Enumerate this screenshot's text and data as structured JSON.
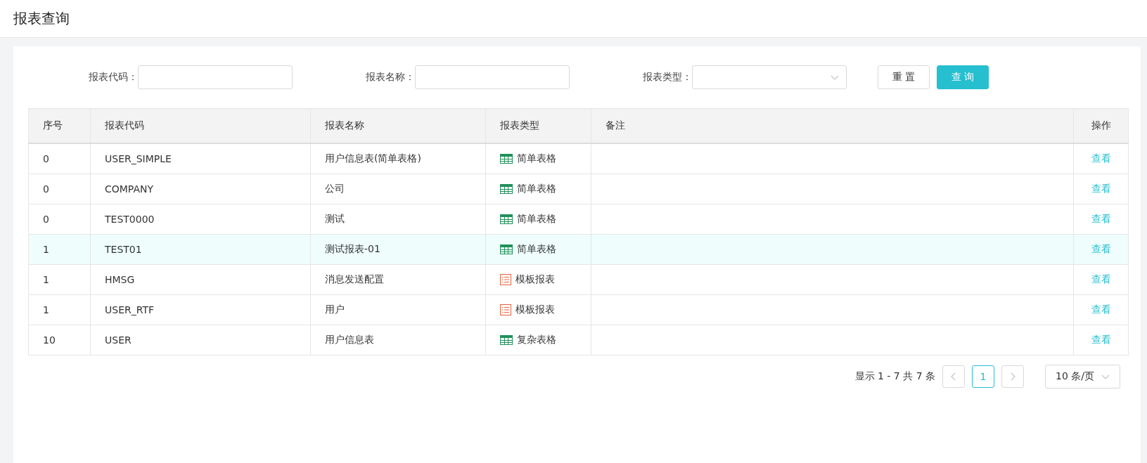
{
  "page_title": "报表查询",
  "filters": [
    {
      "label": "报表代码：",
      "kind": "text"
    },
    {
      "label": "报表名称：",
      "kind": "text"
    },
    {
      "label": "报表类型：",
      "kind": "select"
    }
  ],
  "buttons": [
    {
      "label": "重 置",
      "kind": "default"
    },
    {
      "label": "查 询",
      "kind": "primary"
    }
  ],
  "table": {
    "columns": [
      "序号",
      "报表代码",
      "报表名称",
      "报表类型",
      "备注",
      "操作"
    ],
    "rows": [
      {
        "index": "0",
        "code": "USER_SIMPLE",
        "name": "用户信息表(简单表格)",
        "type": "简单表格",
        "kind": "table",
        "action": "查看",
        "highlighted": false
      },
      {
        "index": "0",
        "code": "COMPANY",
        "name": "公司",
        "type": "简单表格",
        "kind": "table",
        "action": "查看",
        "highlighted": false
      },
      {
        "index": "0",
        "code": "TEST0000",
        "name": "测试",
        "type": "简单表格",
        "kind": "table",
        "action": "查看",
        "highlighted": false
      },
      {
        "index": "1",
        "code": "TEST01",
        "name": "测试报表-01",
        "type": "简单表格",
        "kind": "table",
        "action": "查看",
        "highlighted": true
      },
      {
        "index": "1",
        "code": "HMSG",
        "name": "消息发送配置",
        "type": "模板报表",
        "kind": "template",
        "action": "查看",
        "highlighted": false
      },
      {
        "index": "1",
        "code": "USER_RTF",
        "name": "用户",
        "type": "模板报表",
        "kind": "template",
        "action": "查看",
        "highlighted": false
      },
      {
        "index": "10",
        "code": "USER",
        "name": "用户信息表",
        "type": "复杂表格",
        "kind": "table",
        "action": "查看",
        "highlighted": false
      }
    ]
  },
  "pagination": {
    "summary": "显示 1 - 7 共 7 条",
    "pages": [
      {
        "label": "1",
        "selected": true
      }
    ],
    "page_size": "10 条/页"
  }
}
